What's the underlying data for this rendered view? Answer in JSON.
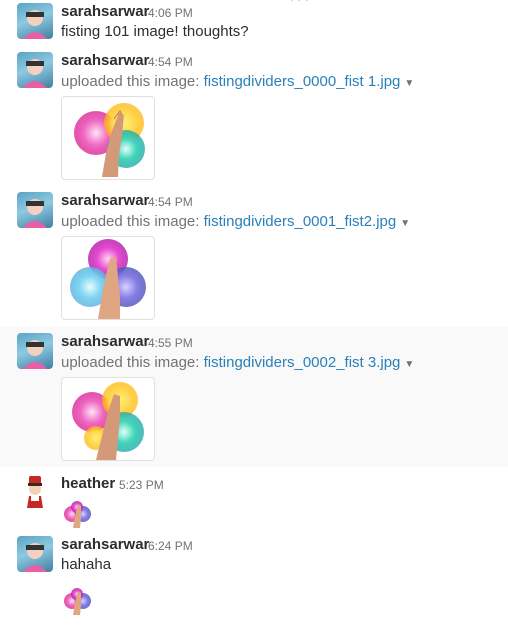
{
  "messages": [
    {
      "author": "sarahsarwar",
      "time": "4:06 PM",
      "text": "fisting 101 image! thoughts?"
    },
    {
      "author": "sarahsarwar",
      "time": "4:54 PM",
      "prefix": "uploaded this image: ",
      "file": "fistingdividers_0000_fist 1.jpg"
    },
    {
      "author": "sarahsarwar",
      "time": "4:54 PM",
      "prefix": "uploaded this image: ",
      "file": "fistingdividers_0001_fist2.jpg"
    },
    {
      "author": "sarahsarwar",
      "time": "4:55 PM",
      "prefix": "uploaded this image: ",
      "file": "fistingdividers_0002_fist 3.jpg"
    },
    {
      "author": "heather",
      "time": "5:23 PM"
    },
    {
      "author": "sarahsarwar",
      "time": "6:24 PM",
      "text": "hahaha"
    }
  ],
  "icons": {
    "avatar_sarah": "avatar-sarah-icon",
    "avatar_heather": "avatar-heather-icon",
    "caret": "caret-down-icon",
    "emoji": "fist-emoji-icon"
  },
  "colors": {
    "link": "#2a80b9",
    "muted": "#717274",
    "text": "#2c2d30",
    "highlight": "#f9f9f9"
  }
}
